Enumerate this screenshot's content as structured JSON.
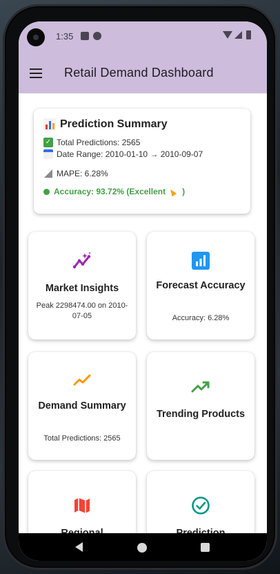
{
  "status_bar": {
    "time": "1:35"
  },
  "app_bar": {
    "title": "Retail Demand Dashboard"
  },
  "summary": {
    "title": "Prediction Summary",
    "total_predictions": "Total Predictions: 2565",
    "date_range": "Date Range: 2010-01-10 → 2010-09-07",
    "mape": "MAPE: 6.28%",
    "accuracy": "Accuracy: 93.72% (Excellent"
  },
  "cards": [
    {
      "title": "Market Insights",
      "subtitle": "Peak 2298474.00 on 2010-07-05",
      "icon": "insights-sparkle-icon",
      "color": "#9c27b0"
    },
    {
      "title": "Forecast Accuracy",
      "subtitle": "Accuracy: 6.28%",
      "icon": "bar-chart-icon",
      "color": "#2196f3"
    },
    {
      "title": "Demand Summary",
      "subtitle": "Total Predictions: 2565",
      "icon": "trending-line-icon",
      "color": "#ff9800"
    },
    {
      "title": "Trending Products",
      "subtitle": "",
      "icon": "trending-up-icon",
      "color": "#43a047"
    },
    {
      "title": "Regional",
      "subtitle": "",
      "icon": "map-icon",
      "color": "#f44336"
    },
    {
      "title": "Prediction",
      "subtitle": "",
      "icon": "check-circle-icon",
      "color": "#009688"
    }
  ],
  "colors": {
    "app_bar": "#cdbcdc",
    "accent_green": "#43a047"
  }
}
